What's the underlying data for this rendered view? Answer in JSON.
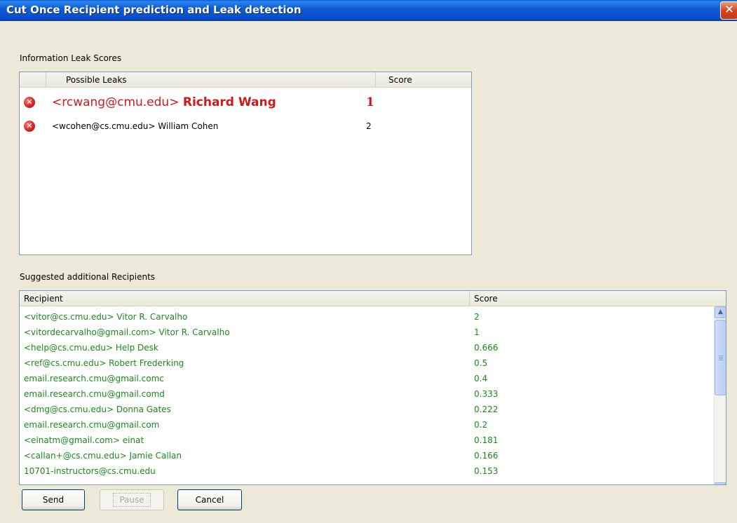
{
  "window": {
    "title": "Cut Once Recipient prediction and Leak detection"
  },
  "leaks": {
    "section_label": "Information Leak Scores",
    "columns": [
      "Possible Leaks",
      "Score"
    ],
    "rows": [
      {
        "email": "<rcwang@cmu.edu>",
        "name": "Richard Wang",
        "score": "1",
        "icon": "error-x-icon",
        "highlighted": true
      },
      {
        "email": "<wcohen@cs.cmu.edu>",
        "name": "William Cohen",
        "score": "2",
        "icon": "error-x-icon",
        "highlighted": false
      }
    ]
  },
  "recipients": {
    "section_label": "Suggested additional Recipients",
    "columns": [
      "Recipient",
      "Score"
    ],
    "rows": [
      {
        "recipient": "<vitor@cs.cmu.edu> Vitor R. Carvalho",
        "score": "2"
      },
      {
        "recipient": "<vitordecarvalho@gmail.com> Vitor R. Carvalho",
        "score": "1"
      },
      {
        "recipient": "<help@cs.cmu.edu> Help Desk",
        "score": "0.666"
      },
      {
        "recipient": "<ref@cs.cmu.edu> Robert Frederking",
        "score": "0.5"
      },
      {
        "recipient": "email.research.cmu@gmail.comc",
        "score": "0.4"
      },
      {
        "recipient": "email.research.cmu@gmail.comd",
        "score": "0.333"
      },
      {
        "recipient": "<dmg@cs.cmu.edu> Donna Gates",
        "score": "0.222"
      },
      {
        "recipient": "email.research.cmu@gmail.com",
        "score": "0.2"
      },
      {
        "recipient": "<einatm@gmail.com> einat",
        "score": "0.181"
      },
      {
        "recipient": "<callan+@cs.cmu.edu> Jamie Callan",
        "score": "0.166"
      },
      {
        "recipient": "10701-instructors@cs.cmu.edu",
        "score": "0.153"
      }
    ],
    "text_color": "#1b8a1b"
  },
  "buttons": {
    "send": "Send",
    "pause": "Pause",
    "cancel": "Cancel"
  },
  "colors": {
    "titlebar": "#0a4fcb",
    "leak_highlight": "#d2171b",
    "window_bg": "#ece9d8"
  }
}
